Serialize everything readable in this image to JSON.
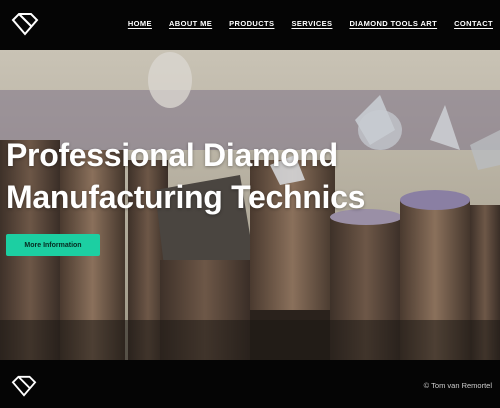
{
  "nav": {
    "items": [
      {
        "label": "HOME"
      },
      {
        "label": "ABOUT ME"
      },
      {
        "label": "PRODUCTS"
      },
      {
        "label": "SERVICES"
      },
      {
        "label": "DIAMOND TOOLS ART"
      },
      {
        "label": "CONTACT"
      }
    ]
  },
  "hero": {
    "title_line1": "Professional Diamond",
    "title_line2": "Manufacturing Technics",
    "cta_label": "More Information"
  },
  "footer": {
    "copyright": "© Tom van Remortel"
  },
  "colors": {
    "accent": "#1ccfa2",
    "bar": "#050505",
    "text": "#ffffff"
  },
  "icons": {
    "logo": "diamond-logo-icon"
  }
}
